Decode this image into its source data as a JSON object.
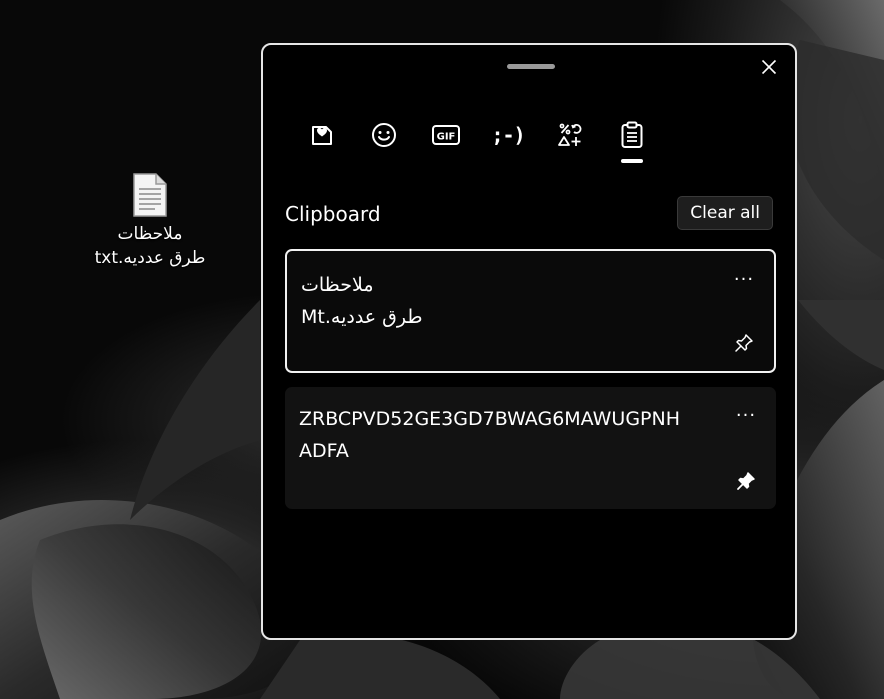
{
  "desktop": {
    "file_icon": {
      "icon": "text-file-icon",
      "label_line1": "ملاحظات",
      "label_line2": "طرق عدديه.txt"
    }
  },
  "clipboard_panel": {
    "close_icon": "close-icon",
    "tabs": [
      {
        "name": "kaomoji-favorites",
        "icon": "heart-sticker-icon",
        "active": false
      },
      {
        "name": "emoji",
        "icon": "smiley-icon",
        "active": false
      },
      {
        "name": "gif",
        "icon": "gif-icon",
        "text": "GIF",
        "active": false
      },
      {
        "name": "kaomoji",
        "icon": "kaomoji-icon",
        "text": ";-)",
        "active": false
      },
      {
        "name": "symbols",
        "icon": "symbols-icon",
        "active": false
      },
      {
        "name": "clipboard",
        "icon": "clipboard-icon",
        "active": true
      }
    ],
    "section_title": "Clipboard",
    "clear_all_label": "Clear all",
    "items": [
      {
        "line1": "ملاحظات",
        "line2": "طرق عدديه.Mt",
        "more_label": "···",
        "pinned": false,
        "selected": true
      },
      {
        "text": "ZRBCPVD52GE3GD7BWAG6MAWUGPNH\nADFA",
        "more_label": "···",
        "pinned": true,
        "selected": false
      }
    ]
  },
  "colors": {
    "panel_bg": "#000000",
    "panel_border": "#e6e6e6",
    "item_bg": "#121212",
    "text": "#ffffff"
  }
}
